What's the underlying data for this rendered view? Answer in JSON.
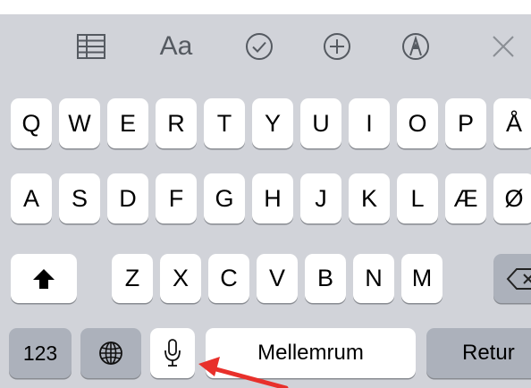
{
  "toolbar": {
    "items": [
      {
        "name": "table-icon"
      },
      {
        "name": "text-format-button",
        "label": "Aa"
      },
      {
        "name": "checklist-icon"
      },
      {
        "name": "add-icon"
      },
      {
        "name": "markup-pen-icon"
      },
      {
        "name": "close-icon"
      }
    ]
  },
  "keyboard": {
    "row1": [
      "Q",
      "W",
      "E",
      "R",
      "T",
      "Y",
      "U",
      "I",
      "O",
      "P",
      "Å"
    ],
    "row2": [
      "A",
      "S",
      "D",
      "F",
      "G",
      "H",
      "J",
      "K",
      "L",
      "Æ",
      "Ø"
    ],
    "row3": [
      "Z",
      "X",
      "C",
      "V",
      "B",
      "N",
      "M"
    ],
    "numbers_label": "123",
    "space_label": "Mellemrum",
    "return_label": "Retur"
  },
  "annotation": {
    "arrow_color": "#e8302b"
  },
  "colors": {
    "keyboard_bg": "#d1d3d9",
    "key_bg": "#ffffff",
    "function_key_bg": "#acb1bb"
  }
}
